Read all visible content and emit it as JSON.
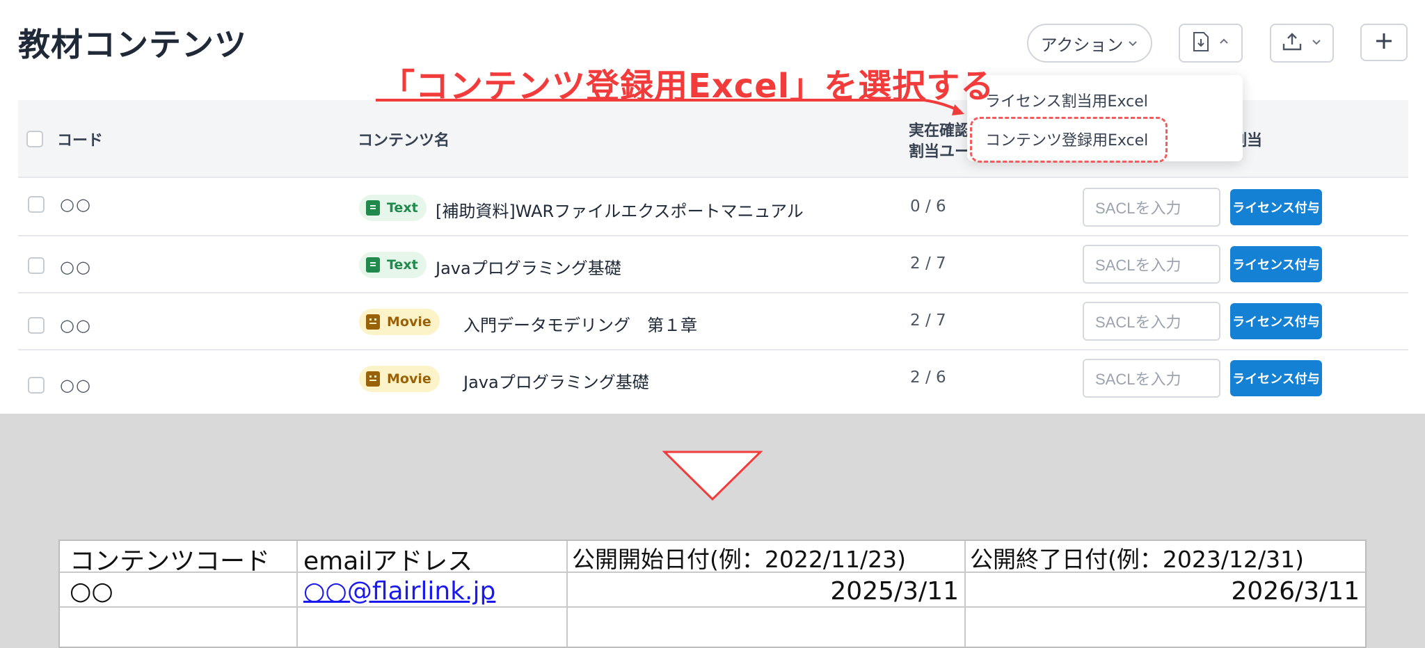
{
  "page": {
    "title": "教材コンテンツ"
  },
  "toolbar": {
    "action_label": "アクション"
  },
  "annotation": "「コンテンツ登録用Excel」を選択する",
  "table": {
    "headers": {
      "code": "コード",
      "name": "コンテンツ名",
      "ratio_line1": "実在確認",
      "ratio_line2": "割当ユー",
      "assign": "割当"
    },
    "rows": [
      {
        "code": "○○",
        "type": "Text",
        "name": "[補助資料]WARファイルエクスポートマニュアル",
        "ratio": "0 / 6",
        "sacl_placeholder": "SACLを入力",
        "button": "ライセンス付与"
      },
      {
        "code": "○○",
        "type": "Text",
        "name": "Javaプログラミング基礎",
        "ratio": "2 / 7",
        "sacl_placeholder": "SACLを入力",
        "button": "ライセンス付与"
      },
      {
        "code": "○○",
        "type": "Movie",
        "name": "入門データモデリング　第１章",
        "ratio": "2 / 7",
        "sacl_placeholder": "SACLを入力",
        "button": "ライセンス付与"
      },
      {
        "code": "○○",
        "type": "Movie",
        "name": "Javaプログラミング基礎",
        "ratio": "2 / 6",
        "sacl_placeholder": "SACLを入力",
        "button": "ライセンス付与"
      }
    ]
  },
  "dropdown": {
    "items": [
      "ライセンス割当用Excel",
      "コンテンツ登録用Excel"
    ]
  },
  "spreadsheet": {
    "headers": [
      "コンテンツコード",
      "emailアドレス",
      "公開開始日付(例：2022/11/23)",
      "公開終了日付(例：2023/12/31)"
    ],
    "row": [
      "○○",
      "○○@flairlink.jp",
      "2025/3/11",
      "2026/3/11"
    ]
  },
  "colors": {
    "accent_red": "#f23b3b",
    "primary_blue": "#1581d4",
    "text_badge": "#1f8a4c",
    "movie_badge": "#9a6208"
  },
  "icons": [
    "chevron-down-icon",
    "file-download-icon",
    "chevron-up-icon",
    "upload-icon",
    "plus-icon",
    "book-icon",
    "film-icon",
    "arrow-icon",
    "down-triangle-icon"
  ]
}
